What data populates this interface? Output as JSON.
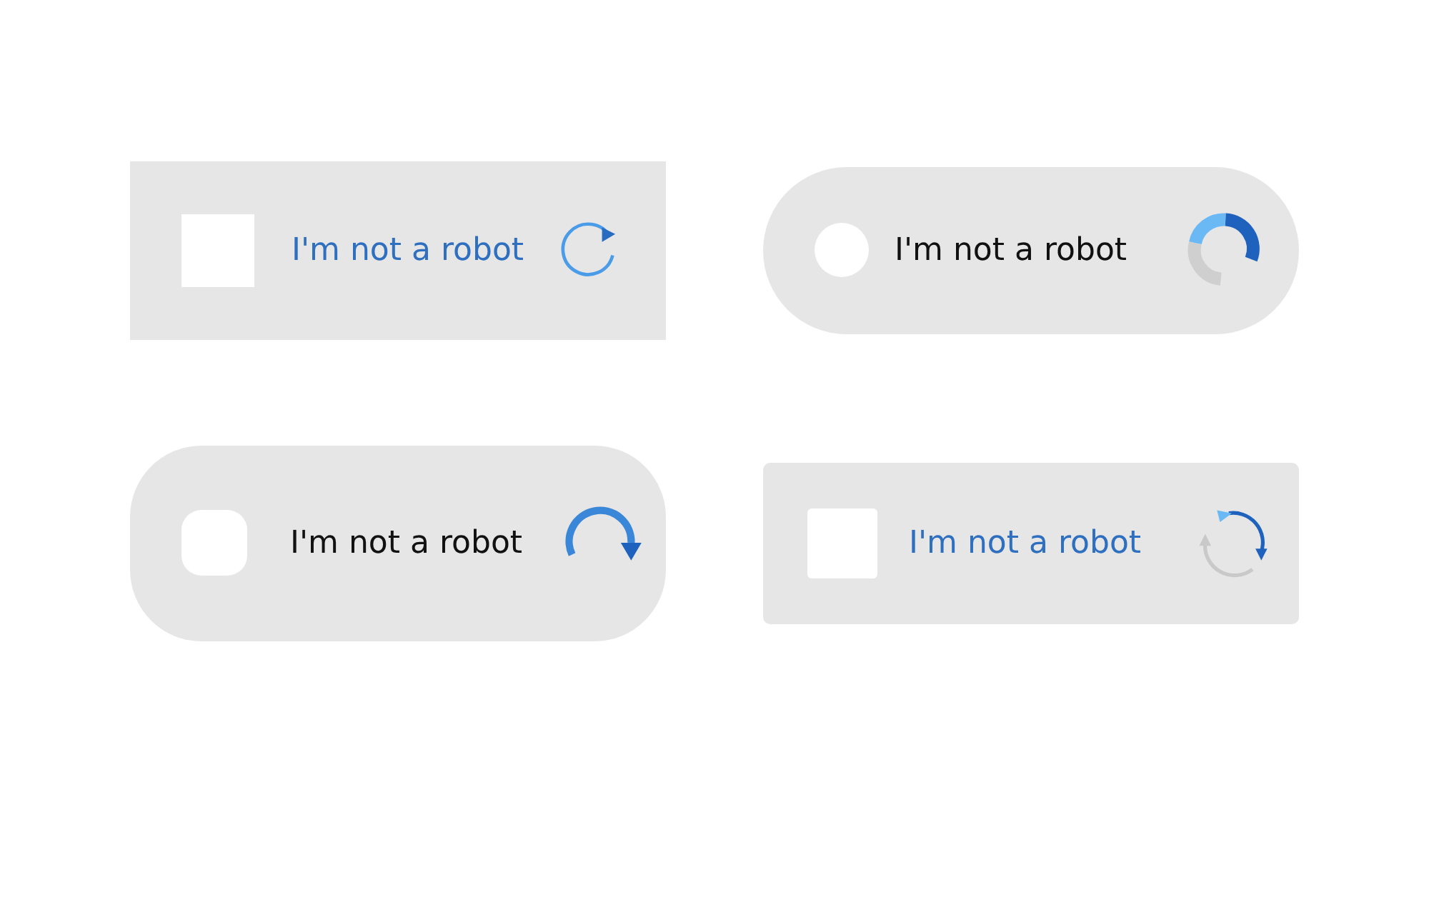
{
  "widgets": [
    {
      "kind": "box",
      "label": "I'm not a robot",
      "checked": false
    },
    {
      "kind": "pill",
      "label": "I'm not a robot",
      "checked": false
    },
    {
      "kind": "soft",
      "label": "I'm not a robot",
      "checked": false
    },
    {
      "kind": "card",
      "label": "I'm not a robot",
      "checked": false
    }
  ]
}
